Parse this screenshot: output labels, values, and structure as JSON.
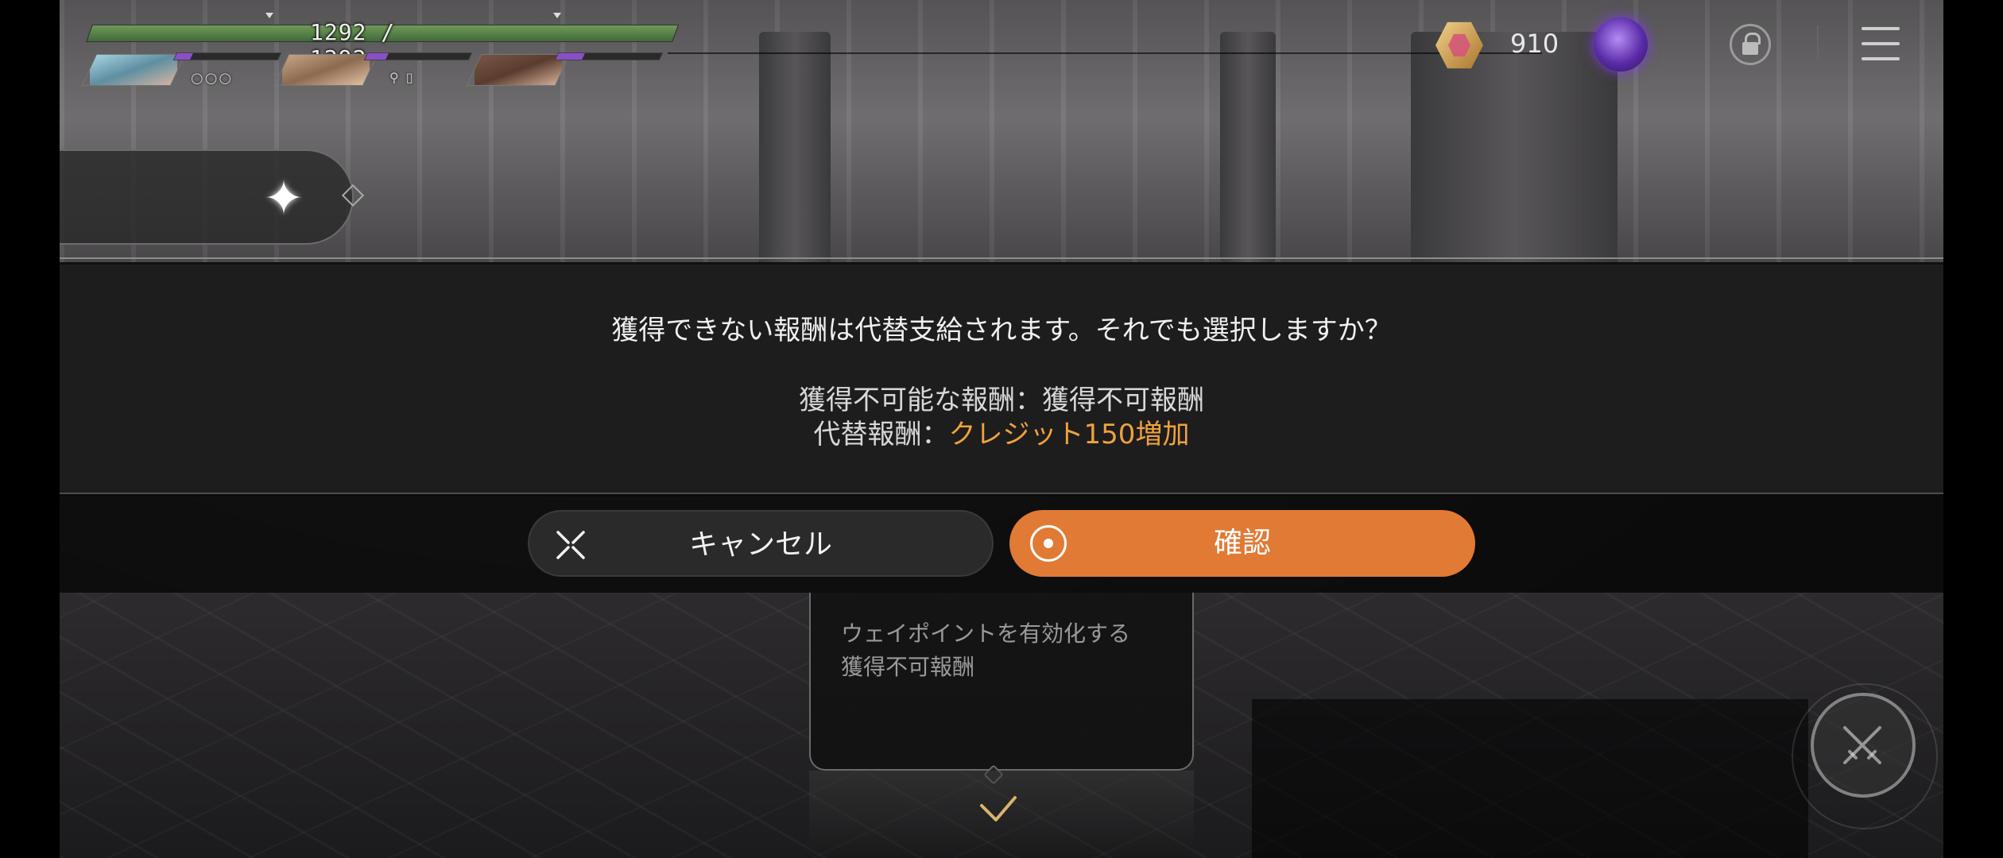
{
  "hud": {
    "hp_text": "1292 / 1292",
    "hp_current": 1292,
    "hp_max": 1292,
    "party": [
      {
        "name": "portrait-1",
        "mana_fill": 0.15
      },
      {
        "name": "portrait-2",
        "mana_fill": 0.2
      },
      {
        "name": "portrait-3",
        "mana_fill": 0.25
      }
    ],
    "charge_dots": "○○○",
    "currency_value": "910",
    "icons": {
      "currency": "gold-hexagon-crystal-icon",
      "orb": "purple-orb-icon",
      "lock": "lock-icon",
      "menu": "hamburger-menu-icon",
      "skill": "crossed-swords-icon"
    }
  },
  "dialog": {
    "question": "獲得できない報酬は代替支給されます。それでも選択しますか？",
    "detail_1_label": "獲得不可能な報酬：",
    "detail_1_value": "獲得不可報酬",
    "detail_2_label": "代替報酬：",
    "detail_2_value": "クレジット150増加",
    "cancel_label": "キャンセル",
    "confirm_label": "確認"
  },
  "tooltip": {
    "line1": "ウェイポイントを有効化する",
    "line2": "獲得不可報酬"
  },
  "colors": {
    "accent": "#e07a35",
    "reward_highlight": "#f0a23c",
    "hp_green": "#5f8d4e",
    "mana_purple": "#8a4fc8"
  }
}
